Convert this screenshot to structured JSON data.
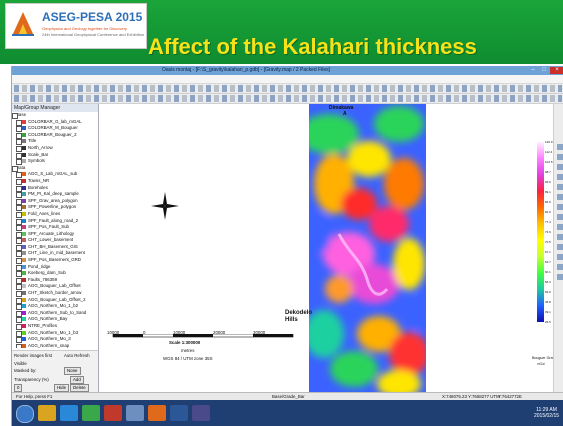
{
  "slide": {
    "logo_title": "ASEG-PESA 2015",
    "logo_subtitle": "Geophysics and Geology together for Discovery",
    "logo_detail": "24th International Geophysical Conference and Exhibition",
    "title": "Affect of the Kalahari thickness",
    "colors": {
      "bar": "#129a35",
      "title": "#f6e21a"
    }
  },
  "window": {
    "title": "Oasis montaj - [F:\\S_gravity\\kalahari_p.gdb] - [Gravity.map / 2 Packed Files]"
  },
  "menu": [
    "File",
    "Edit",
    "GX",
    "Database",
    "Map",
    "Arc/GIS-MXD",
    "Coordinates",
    "Database Tools",
    "Grid and Image",
    "Map Tools",
    "3D",
    "Seeker",
    "GM-SYS",
    "Montaj Plus",
    "Gravity",
    "Magmap",
    "UX-Detect",
    "Window",
    "Help"
  ],
  "layers": {
    "panel_title": "Map/Group Manager",
    "items": [
      {
        "label": "Base",
        "group": true
      },
      {
        "label": "COLORBAR_G_lab_mGAL",
        "swatch": "#e04040"
      },
      {
        "label": "COLORBAR_M_Bouguer",
        "swatch": "#3060c0"
      },
      {
        "label": "COLORBAR_Bouguer_2",
        "swatch": "#40a040"
      },
      {
        "label": "Title",
        "swatch": "#777777"
      },
      {
        "label": "North_Arrow",
        "swatch": "#333333"
      },
      {
        "label": "Scale_Bar",
        "swatch": "#333333"
      },
      {
        "label": "Symbols",
        "swatch": "#aaaaaa"
      },
      {
        "label": "Data",
        "group": true
      },
      {
        "label": "AGG_S_Lab_mGAL_sub",
        "swatch": "#e06020"
      },
      {
        "label": "Towns_NR",
        "swatch": "#c03030"
      },
      {
        "label": "Boreholes",
        "swatch": "#303090"
      },
      {
        "label": "PM_PI_Kal_deep_sample",
        "swatch": "#40a0a0"
      },
      {
        "label": "SPF_Grav_area_polygon",
        "swatch": "#8040a0"
      },
      {
        "label": "SPF_Powerline_polygon",
        "swatch": "#a07030"
      },
      {
        "label": "Fold_Axes_lines",
        "swatch": "#c0c000"
      },
      {
        "label": "SPF_Fault_along_road_2",
        "swatch": "#2080c0"
      },
      {
        "label": "SPF_Pos_Fault_Sub",
        "swatch": "#c04080"
      },
      {
        "label": "SPF_Arcuate_Lithology",
        "swatch": "#60c060"
      },
      {
        "label": "CHT_Lower_basement",
        "swatch": "#c06060"
      },
      {
        "label": "CHT_BH_Basement_GIS",
        "swatch": "#6060c0"
      },
      {
        "label": "CHT_Line_in_mid_basement",
        "swatch": "#909090"
      },
      {
        "label": "SPF_Pos_Basement_GRD",
        "swatch": "#d09050"
      },
      {
        "label": "Pond_ridge",
        "swatch": "#5090d0"
      },
      {
        "label": "Koeberg_dam_Sub",
        "swatch": "#50b050"
      },
      {
        "label": "Faults_786359",
        "swatch": "#b03030"
      },
      {
        "label": "AGG_Bouguer_Lab_Offset",
        "swatch": "#c0c0c0"
      },
      {
        "label": "CHT_Sketch_border_arrow",
        "swatch": "#707070"
      },
      {
        "label": "AGG_Bouguer_Lab_Offset_2",
        "swatch": "#d0a020"
      },
      {
        "label": "AGG_Northern_Mo_1_b2",
        "swatch": "#20a0d0"
      },
      {
        "label": "AGG_Northern_Sub_to_Sand",
        "swatch": "#a020d0"
      },
      {
        "label": "AGG_Northern_Bay",
        "swatch": "#20d0a0"
      },
      {
        "label": "NTRE_Profiles",
        "swatch": "#d02060"
      },
      {
        "label": "AGG_Northern_Mo_1_b3",
        "swatch": "#60d020"
      },
      {
        "label": "AGG_Northern_Mo_3",
        "swatch": "#2060d0"
      },
      {
        "label": "AGG_Northern_snap",
        "swatch": "#d06020"
      },
      {
        "label": "AGG_Northern_snap_2",
        "swatch": "#6020d0"
      },
      {
        "label": "Basement_contour",
        "swatch": "#202020"
      }
    ]
  },
  "panel_options": {
    "render_images": "Render images first",
    "auto_refresh": "Auto Refresh",
    "visible": "Visible",
    "mask_label": "Masked by:",
    "mask_value": "None",
    "transparency": "Transparency (%)",
    "transparency_value": "0",
    "add_button": "Add",
    "delete_button": "Delete",
    "hide_button": "Hide"
  },
  "map": {
    "top_label": "Dimakawa",
    "top_label_sub": "A",
    "site_label": "Dekodelo",
    "site_label_sub": "Hills",
    "scale_title": "Scale 1:300000",
    "scale_ticks": [
      "10000",
      "0",
      "10000",
      "20000",
      "30000"
    ],
    "scale_unit": "metres",
    "projection": "WGS 84 / UTM zone 35S"
  },
  "legend": {
    "ticks": [
      "126.9",
      "112.4",
      "104.5",
      "98.7",
      "93.6",
      "89.1",
      "84.9",
      "81.0",
      "77.4",
      "73.9",
      "70.5",
      "67.1",
      "63.7",
      "60.1",
      "56.3",
      "52.0",
      "46.8",
      "39.1",
      "26.5"
    ],
    "title": "Bouguer Gravity",
    "unit": "mGal"
  },
  "status": {
    "left": "For Help, press F1",
    "middle": "Base/Grade_Bar",
    "coord1": "X:746075.23 Y:7658277 UTM",
    "coord2": "Y:7642772E"
  },
  "taskbar": {
    "time": "11:29 AM",
    "date": "2015/02/15"
  }
}
